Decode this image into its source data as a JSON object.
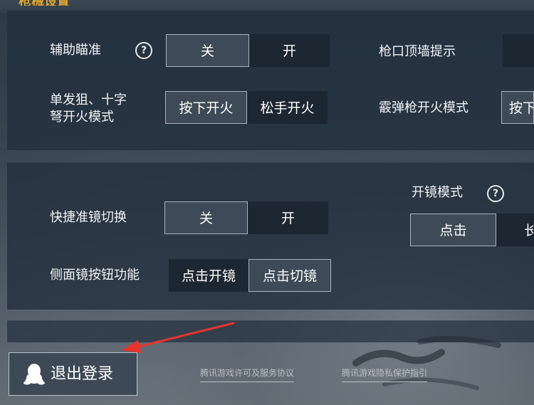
{
  "section_title": "枪械设置",
  "fire_settings": {
    "aim_assist": {
      "label": "辅助瞄准",
      "help": "?",
      "options": [
        "关",
        "开"
      ],
      "selected": "关"
    },
    "muzzle_wall_hint": {
      "label": "枪口顶墙提示"
    },
    "sniper_crossbow_fire_mode": {
      "label_line1": "单发狙、十字",
      "label_line2": "弩开火模式",
      "options": [
        "按下开火",
        "松手开火"
      ],
      "selected": "按下开火"
    },
    "shotgun_fire_mode": {
      "label": "霰弹枪开火模式",
      "visible_option": "按下"
    }
  },
  "scope_settings": {
    "quick_scope_switch": {
      "label": "快捷准镜切换",
      "options": [
        "关",
        "开"
      ],
      "selected": "关"
    },
    "side_scope_button": {
      "label": "侧面镜按钮功能",
      "options": [
        "点击开镜",
        "点击切镜"
      ],
      "selected": "点击切镜"
    },
    "scope_mode": {
      "label": "开镜模式",
      "help": "?",
      "options": [
        "点击",
        "长"
      ],
      "selected": "点击"
    }
  },
  "footer": {
    "logout_label": "退出登录",
    "logout_icon": "qq-penguin-icon",
    "license_link": "腾讯游戏许可及服务协议",
    "privacy_link": "腾讯游戏隐私保护指引"
  },
  "colors": {
    "accent": "#e0a52f",
    "arrow": "#e8332c",
    "panel": "#222f3c",
    "option_selected": "#3e4b56",
    "option_unselected": "#1c2731"
  }
}
